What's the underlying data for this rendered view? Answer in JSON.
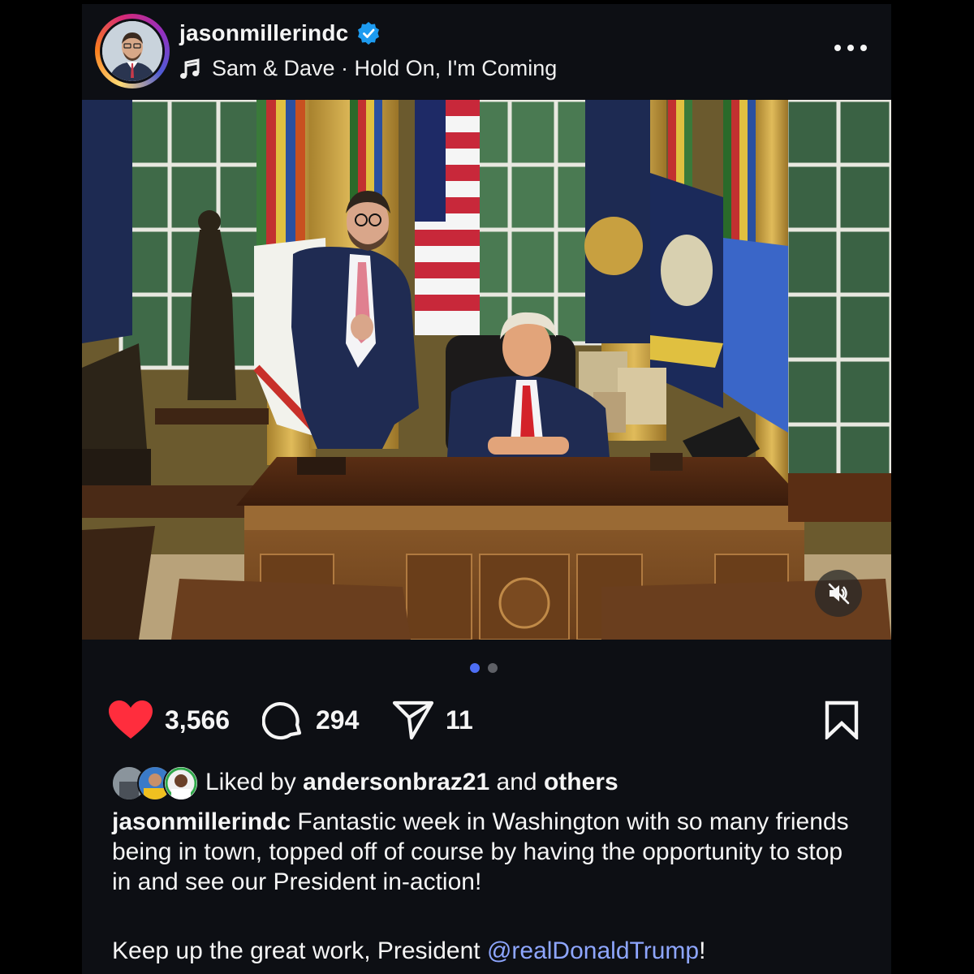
{
  "post": {
    "username": "jasonmillerindc",
    "verified": true,
    "audio": "Sam & Dave · Hold On, I'm Coming",
    "more_menu_icon": "more-horizontal-icon"
  },
  "media": {
    "carousel_count": 2,
    "carousel_active": 0,
    "mute_icon": "speaker-muted-icon",
    "photo_description_icons": [
      "flag-icon"
    ]
  },
  "actions": {
    "likes": "3,566",
    "comments": "294",
    "shares": "11",
    "like_icon": "heart-filled-icon",
    "comment_icon": "comment-icon",
    "share_icon": "send-icon",
    "save_icon": "bookmark-icon"
  },
  "liked_by": {
    "prefix": "Liked by",
    "user": "andersonbraz21",
    "middle": "and",
    "suffix": "others"
  },
  "caption": {
    "user": "jasonmillerindc",
    "text": "Fantastic week in Washington with so many friends being in town, topped off of course by having the opportunity to stop in and see our President in-action!",
    "line2_text": "Keep up the great work, President",
    "mention": "@realDonaldTrump",
    "line2_end": "!"
  },
  "colors": {
    "background": "#0d0f14",
    "heart": "#ff2d3d",
    "verified": "#1d9bf0",
    "dot_active": "#4d6ef5",
    "mention": "#8ea6ff"
  }
}
